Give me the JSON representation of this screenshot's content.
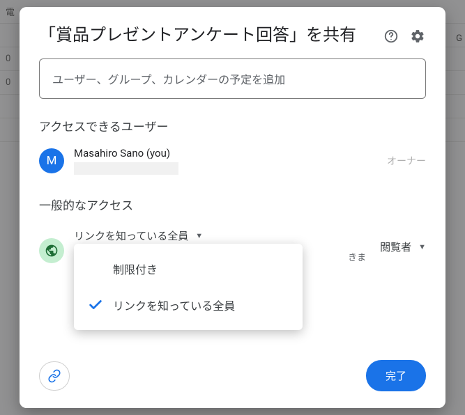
{
  "backdrop": {
    "row_labels": [
      "電",
      "0",
      "0"
    ],
    "right_label": "G"
  },
  "dialog": {
    "title": "「賞品プレゼントアンケート回答」を共有",
    "add_placeholder": "ユーザー、グループ、カレンダーの予定を追加",
    "sections": {
      "access_users_title": "アクセスできるユーザー",
      "general_access_title": "一般的なアクセス"
    },
    "person": {
      "avatar_letter": "M",
      "name": "Masahiro Sano (you)",
      "role": "オーナー"
    },
    "general_access": {
      "selected_label": "リンクを知っている全員",
      "description_fragment": "きま",
      "role_label": "閲覧者",
      "menu": {
        "restricted": "制限付き",
        "anyone_link": "リンクを知っている全員"
      }
    },
    "footer": {
      "done": "完了"
    }
  }
}
